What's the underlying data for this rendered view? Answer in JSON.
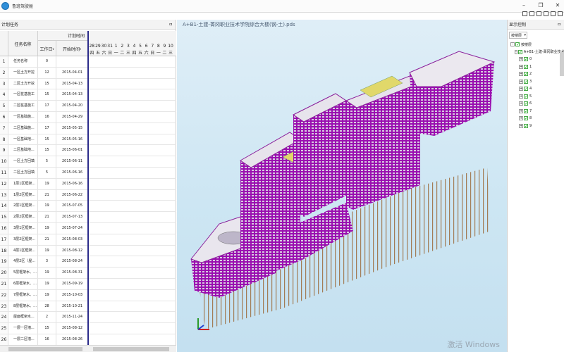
{
  "window": {
    "title": "鲁班驾驶舱"
  },
  "left_panel": {
    "title": "计划任务",
    "pin_glyph": "ㅁ",
    "headers": {
      "task_name": "任务名称",
      "plan_time": "计划时间",
      "work_days": "工作日",
      "start_time": "开始时间"
    },
    "gantt_dates": [
      "28",
      "29",
      "30",
      "31",
      "1",
      "2",
      "3",
      "4",
      "5",
      "6",
      "7",
      "8",
      "9",
      "10"
    ],
    "gantt_weekdays": [
      "四",
      "五",
      "六",
      "日",
      "一",
      "二",
      "三",
      "四",
      "五",
      "六",
      "日",
      "一",
      "二",
      "三"
    ],
    "rows": [
      {
        "num": "1",
        "name": "任务名称",
        "days": "0",
        "start": ""
      },
      {
        "num": "2",
        "name": "一区土方开挖",
        "days": "12",
        "start": "2015-04-01"
      },
      {
        "num": "3",
        "name": "二区土方开挖",
        "days": "15",
        "start": "2015-04-13"
      },
      {
        "num": "4",
        "name": "一区桩基施工",
        "days": "15",
        "start": "2015-04-13"
      },
      {
        "num": "5",
        "name": "二区桩基施工",
        "days": "17",
        "start": "2015-04-20"
      },
      {
        "num": "6",
        "name": "一区基础施...",
        "days": "16",
        "start": "2015-04-29"
      },
      {
        "num": "7",
        "name": "二区基础施...",
        "days": "17",
        "start": "2015-05-15"
      },
      {
        "num": "8",
        "name": "一区基础地...",
        "days": "15",
        "start": "2015-05-16"
      },
      {
        "num": "9",
        "name": "二区基础地...",
        "days": "15",
        "start": "2015-06-01"
      },
      {
        "num": "10",
        "name": "一区土方回填",
        "days": "5",
        "start": "2015-06-11"
      },
      {
        "num": "11",
        "name": "二区土方回填",
        "days": "5",
        "start": "2015-06-16"
      },
      {
        "num": "12",
        "name": "1层1区框架...",
        "days": "19",
        "start": "2015-06-16"
      },
      {
        "num": "13",
        "name": "1层2区框架...",
        "days": "21",
        "start": "2015-06-22"
      },
      {
        "num": "14",
        "name": "2层1区框架...",
        "days": "19",
        "start": "2015-07-05"
      },
      {
        "num": "15",
        "name": "2层2区框架...",
        "days": "21",
        "start": "2015-07-13"
      },
      {
        "num": "16",
        "name": "3层1区框架...",
        "days": "19",
        "start": "2015-07-24"
      },
      {
        "num": "17",
        "name": "3层2区框架...",
        "days": "21",
        "start": "2015-08-03"
      },
      {
        "num": "18",
        "name": "4层1区框架...",
        "days": "19",
        "start": "2015-08-12"
      },
      {
        "num": "19",
        "name": "4层2区（屋...",
        "days": "3",
        "start": "2015-08-24"
      },
      {
        "num": "20",
        "name": "5层框架水、...",
        "days": "19",
        "start": "2015-08-31"
      },
      {
        "num": "21",
        "name": "6层框架水、...",
        "days": "19",
        "start": "2015-09-19"
      },
      {
        "num": "22",
        "name": "7层框架水、...",
        "days": "19",
        "start": "2015-10-03"
      },
      {
        "num": "23",
        "name": "8层框架水、...",
        "days": "28",
        "start": "2015-10-21"
      },
      {
        "num": "24",
        "name": "屋面框架水...",
        "days": "2",
        "start": "2015-11-24"
      },
      {
        "num": "25",
        "name": "一层一区墙...",
        "days": "15",
        "start": "2015-08-12"
      },
      {
        "num": "26",
        "name": "一层二区墙...",
        "days": "16",
        "start": "2015-08-26"
      }
    ]
  },
  "viewport": {
    "document_title": "A+B1-土建-菁冈职业技术学院综合大楼(钢-土).pds",
    "watermark": "激活 Windows"
  },
  "right_panel": {
    "title": "显示控制",
    "pin_glyph": "ㅁ",
    "dropdown_value": "按楼层",
    "tree": [
      {
        "level": 0,
        "label": "按楼层",
        "expander": "-"
      },
      {
        "level": 1,
        "label": "A+B1-土建-菁冈职业技术...",
        "expander": "-"
      },
      {
        "level": 2,
        "label": "0",
        "expander": "+"
      },
      {
        "level": 2,
        "label": "1",
        "expander": "+"
      },
      {
        "level": 2,
        "label": "2",
        "expander": "+"
      },
      {
        "level": 2,
        "label": "3",
        "expander": "+"
      },
      {
        "level": 2,
        "label": "4",
        "expander": "+"
      },
      {
        "level": 2,
        "label": "5",
        "expander": "+"
      },
      {
        "level": 2,
        "label": "6",
        "expander": "+"
      },
      {
        "level": 2,
        "label": "7",
        "expander": "+"
      },
      {
        "level": 2,
        "label": "8",
        "expander": "+"
      },
      {
        "level": 2,
        "label": "9",
        "expander": "+"
      }
    ]
  },
  "colors": {
    "accent_marker": "#2b2b8a",
    "building_wall": "#9a0fb0",
    "viewport_bg": "#d4e9f4"
  }
}
